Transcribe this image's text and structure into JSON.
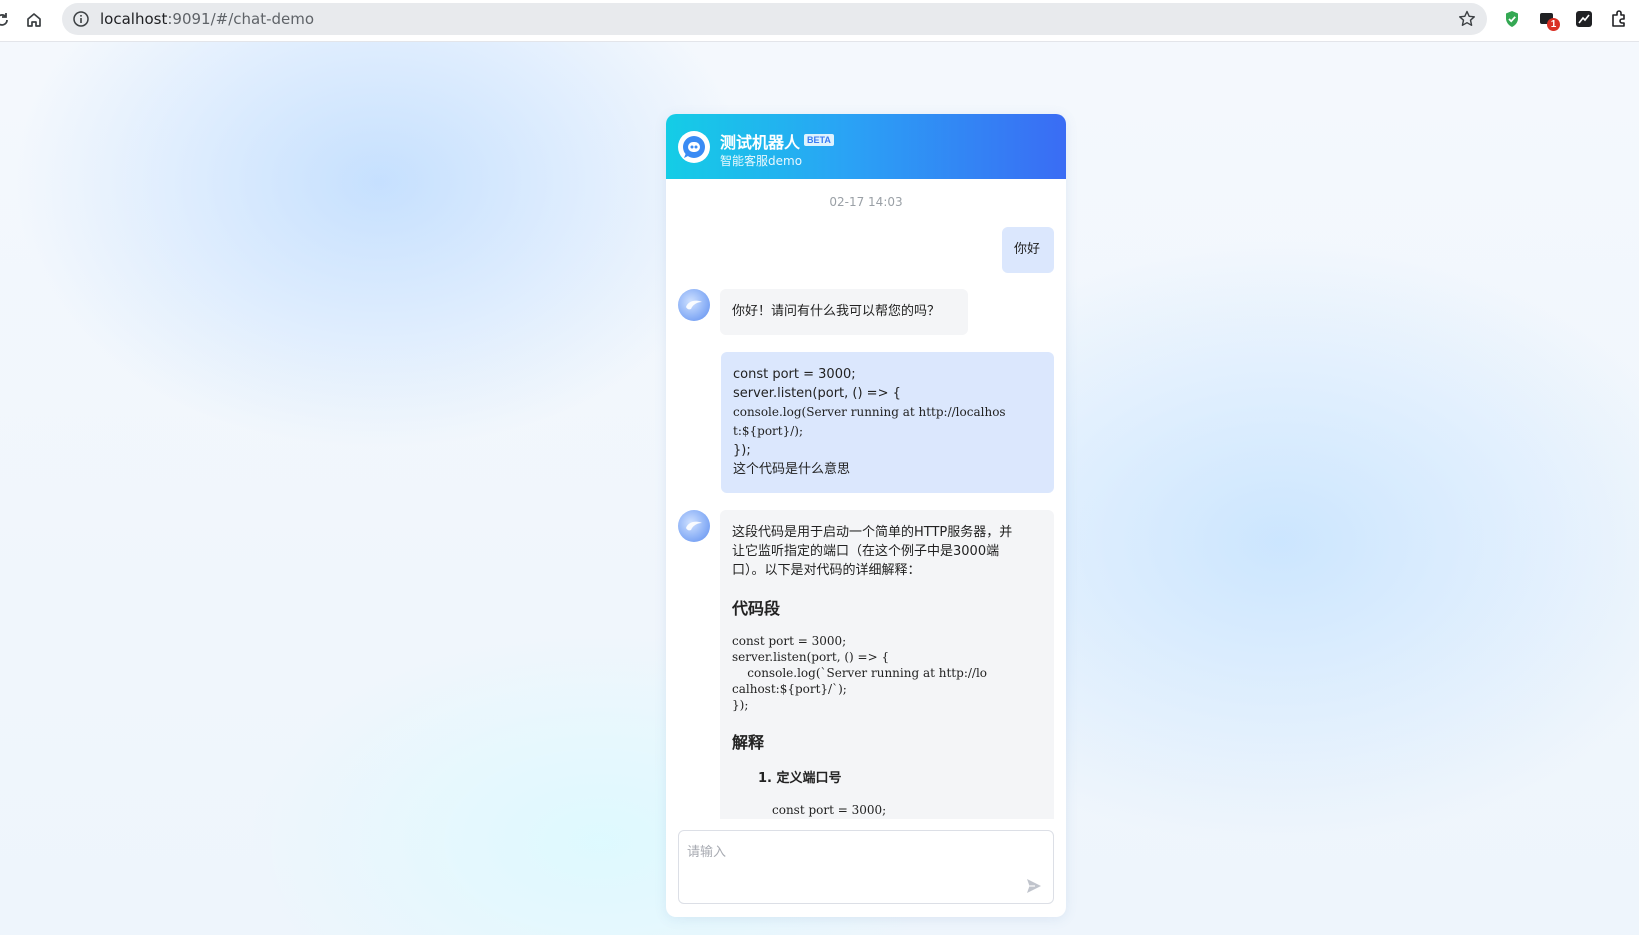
{
  "browser": {
    "url_host": "localhost",
    "url_rest": ":9091/#/chat-demo",
    "extension_badge": "1"
  },
  "chat": {
    "title": "测试机器人",
    "badge": "BETA",
    "subtitle": "智能客服demo",
    "timestamp": "02-17 14:03",
    "user_msg_1": "你好",
    "bot_msg_1": "你好！请问有什么我可以帮您的吗？",
    "user_msg_2": {
      "lines": [
        "const port = 3000;",
        "server.listen(port, () => {",
        "console.log(Server running at http://localhos",
        "t:${port}/);",
        "});",
        "这个代码是什么意思"
      ]
    },
    "bot_msg_2": {
      "intro_lines": [
        "这段代码是用于启动一个简单的HTTP服务器，并",
        "让它监听指定的端口（在这个例子中是3000端",
        "口）。以下是对代码的详细解释："
      ],
      "heading_1": "代码段",
      "code_lines": [
        "const port = 3000;",
        "server.listen(port, () => {",
        "    console.log(`Server running at http://lo",
        "calhost:${port}/`);",
        "});"
      ],
      "heading_2": "解释",
      "list_item_1": "1. 定义端口号",
      "list_code_1": "const port = 3000;"
    },
    "input_placeholder": "请输入"
  }
}
